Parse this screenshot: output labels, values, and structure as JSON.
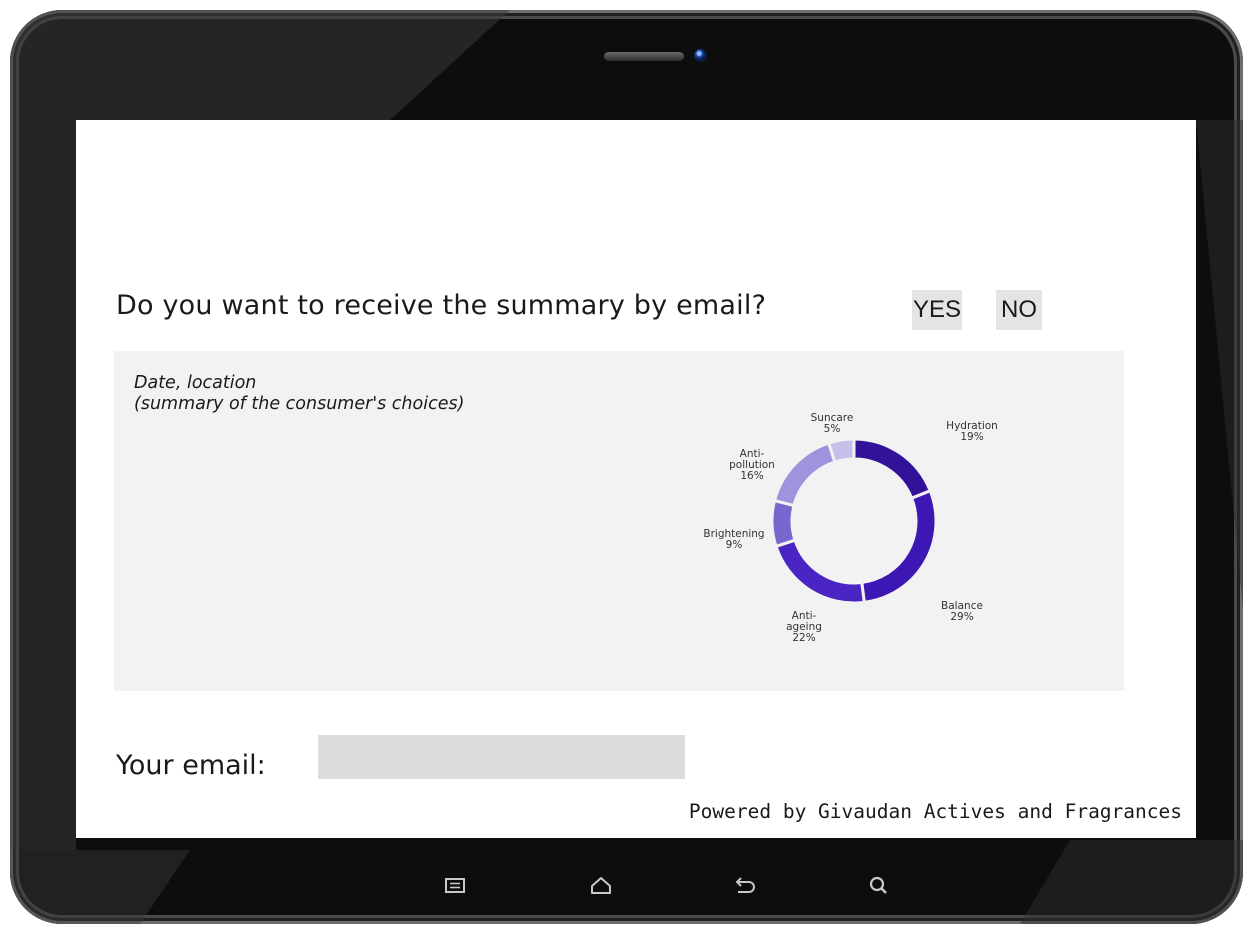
{
  "question": {
    "text": "Do you want to receive the summary by email?",
    "yes_label": "YES",
    "no_label": "NO"
  },
  "summary": {
    "line1": "Date, location",
    "line2": "(summary of the consumer's choices)"
  },
  "chart_data": {
    "type": "pie",
    "variant": "donut",
    "slices": [
      {
        "name": "Hydration",
        "value": 19,
        "label": "19%",
        "color": "#33129a"
      },
      {
        "name": "Balance",
        "value": 29,
        "label": "29%",
        "color": "#3c17b4"
      },
      {
        "name": "Anti-ageing",
        "value": 22,
        "label": "22%",
        "color": "#4a25c4"
      },
      {
        "name": "Brightening",
        "value": 9,
        "label": "9%",
        "color": "#7a66cf"
      },
      {
        "name": "Anti-pollution",
        "value": 16,
        "label": "16%",
        "color": "#a092dc"
      },
      {
        "name": "Suncare",
        "value": 5,
        "label": "5%",
        "color": "#c7bfe9"
      }
    ],
    "title": ""
  },
  "email": {
    "label": "Your email:",
    "value": "",
    "placeholder": ""
  },
  "footer": {
    "powered": "Powered by Givaudan Actives and Fragrances"
  },
  "nav": [
    "menu-icon",
    "home-icon",
    "back-icon",
    "search-icon"
  ]
}
